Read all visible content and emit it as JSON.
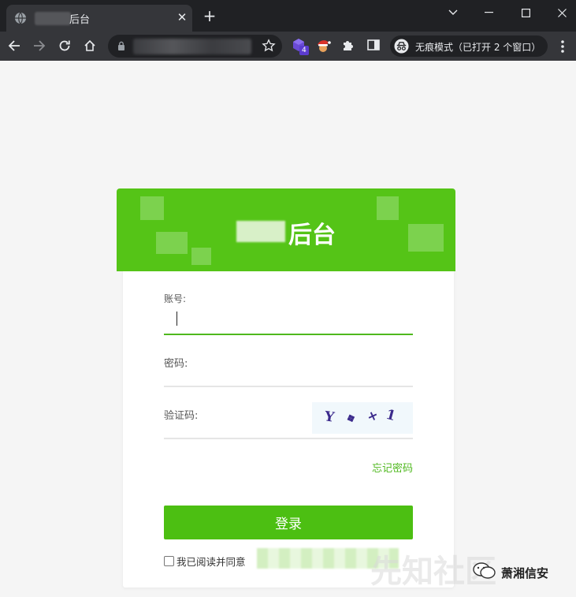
{
  "browser": {
    "tab": {
      "title": "后台",
      "favicon": "globe-icon",
      "close": "✕"
    },
    "new_tab": "+",
    "window_controls": [
      "chevron-down-icon",
      "minimize-icon",
      "maximize-icon",
      "close-icon"
    ],
    "toolbar": {
      "nav": [
        "back-arrow-icon",
        "forward-arrow-icon",
        "reload-icon",
        "home-icon"
      ],
      "omnibox_url": "",
      "bookmark_icon": "star-icon",
      "extensions": [
        {
          "icon": "extension-cube-icon",
          "badge": "4"
        },
        {
          "icon": "extension-santa-icon"
        },
        {
          "icon": "puzzle-icon"
        },
        {
          "icon": "side-panel-icon"
        }
      ],
      "incognito_label": "无痕模式（已打开 2 个窗口）",
      "menu_icon": "kebab-menu-icon"
    }
  },
  "login": {
    "title": "后台",
    "account_label": "账号:",
    "password_label": "密码:",
    "captcha_label": "验证码:",
    "captcha_chars": [
      "Y",
      "❖",
      "+",
      "1"
    ],
    "forgot_link": "忘记密码",
    "login_button": "登录",
    "agree_text": "我已阅读并同意"
  },
  "colors": {
    "accent_green": "#4cbf12",
    "chrome_dark": "#202124",
    "chrome_toolbar": "#35363a"
  },
  "watermark": {
    "text": "先知社区",
    "account": "萧湘信安"
  }
}
